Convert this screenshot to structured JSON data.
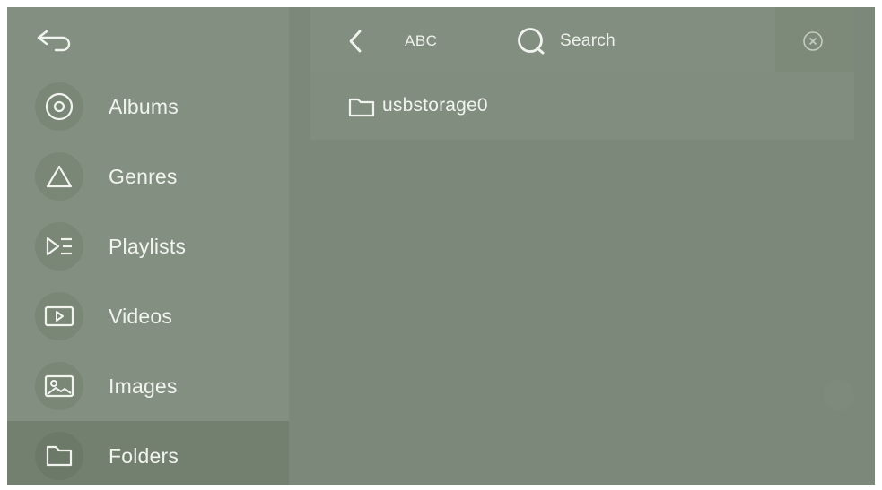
{
  "header": {
    "back_icon": "return-arrow-icon"
  },
  "sidebar": {
    "items": [
      {
        "label": "Albums",
        "icon": "disc-icon",
        "active": false
      },
      {
        "label": "Genres",
        "icon": "triangle-icon",
        "active": false
      },
      {
        "label": "Playlists",
        "icon": "playlist-icon",
        "active": false
      },
      {
        "label": "Videos",
        "icon": "video-icon",
        "active": false
      },
      {
        "label": "Images",
        "icon": "image-icon",
        "active": false
      },
      {
        "label": "Folders",
        "icon": "folder-icon",
        "active": true
      }
    ]
  },
  "toolbar": {
    "back_icon": "chevron-left-icon",
    "sort_label": "ABC",
    "search_label": "Search",
    "search_icon": "search-icon",
    "clear_icon": "clear-icon"
  },
  "folders": [
    {
      "name": "usbstorage0",
      "icon": "folder-icon"
    }
  ],
  "colors": {
    "background": "#7c887a",
    "sidebar": "#838f80",
    "active_item": "#73806f",
    "text": "#f1f3ef"
  }
}
